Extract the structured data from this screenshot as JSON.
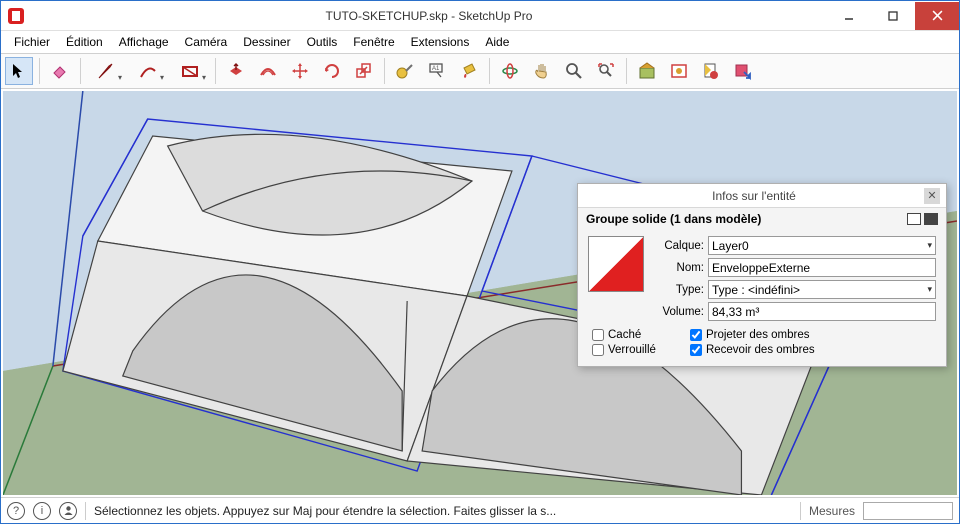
{
  "window": {
    "title": "TUTO-SKETCHUP.skp - SketchUp Pro"
  },
  "menu": {
    "items": [
      "Fichier",
      "Édition",
      "Affichage",
      "Caméra",
      "Dessiner",
      "Outils",
      "Fenêtre",
      "Extensions",
      "Aide"
    ]
  },
  "entity_info": {
    "title": "Infos sur l'entité",
    "group_header": "Groupe solide (1 dans modèle)",
    "labels": {
      "layer": "Calque:",
      "name": "Nom:",
      "type": "Type:",
      "volume": "Volume:"
    },
    "values": {
      "layer": "Layer0",
      "name": "EnveloppeExterne",
      "type": "Type : <indéfini>",
      "volume": "84,33 m³"
    },
    "checkboxes": {
      "hidden": "Caché",
      "locked": "Verrouillé",
      "cast_shadows": "Projeter des ombres",
      "receive_shadows": "Recevoir des ombres"
    }
  },
  "status": {
    "hint": "Sélectionnez les objets. Appuyez sur Maj pour étendre la sélection. Faites glisser la s...",
    "measures_label": "Mesures"
  }
}
